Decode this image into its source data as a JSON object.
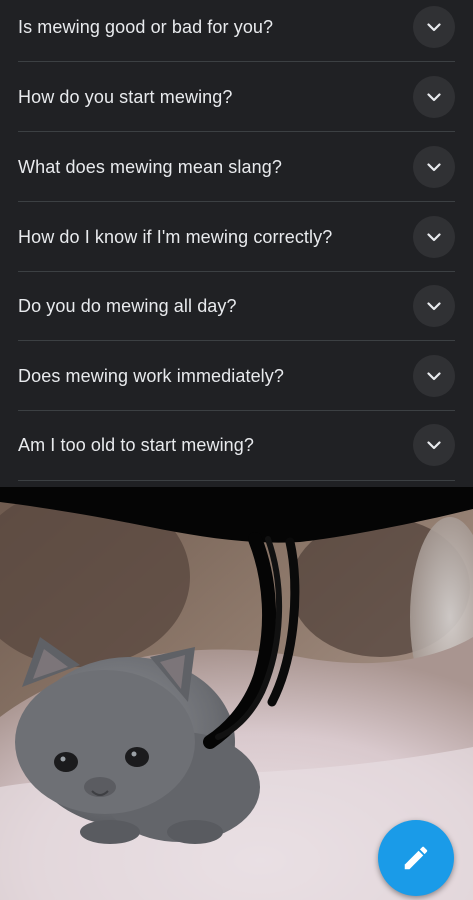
{
  "faq": {
    "questions": [
      {
        "label": "Is mewing good or bad for you?"
      },
      {
        "label": "How do you start mewing?"
      },
      {
        "label": "What does mewing mean slang?"
      },
      {
        "label": "How do I know if I'm mewing correctly?"
      },
      {
        "label": "Do you do mewing all day?"
      },
      {
        "label": "Does mewing work immediately?"
      },
      {
        "label": "Am I too old to start mewing?"
      }
    ],
    "expand_icon": "chevron-down-icon"
  },
  "media": {
    "subject": "gray kitten photo with black marker scribble"
  },
  "fab": {
    "icon": "pencil-icon",
    "color": "#1a9be8"
  },
  "colors": {
    "panel": "#202124",
    "text": "#e8eaed",
    "divider": "#3c4043"
  }
}
